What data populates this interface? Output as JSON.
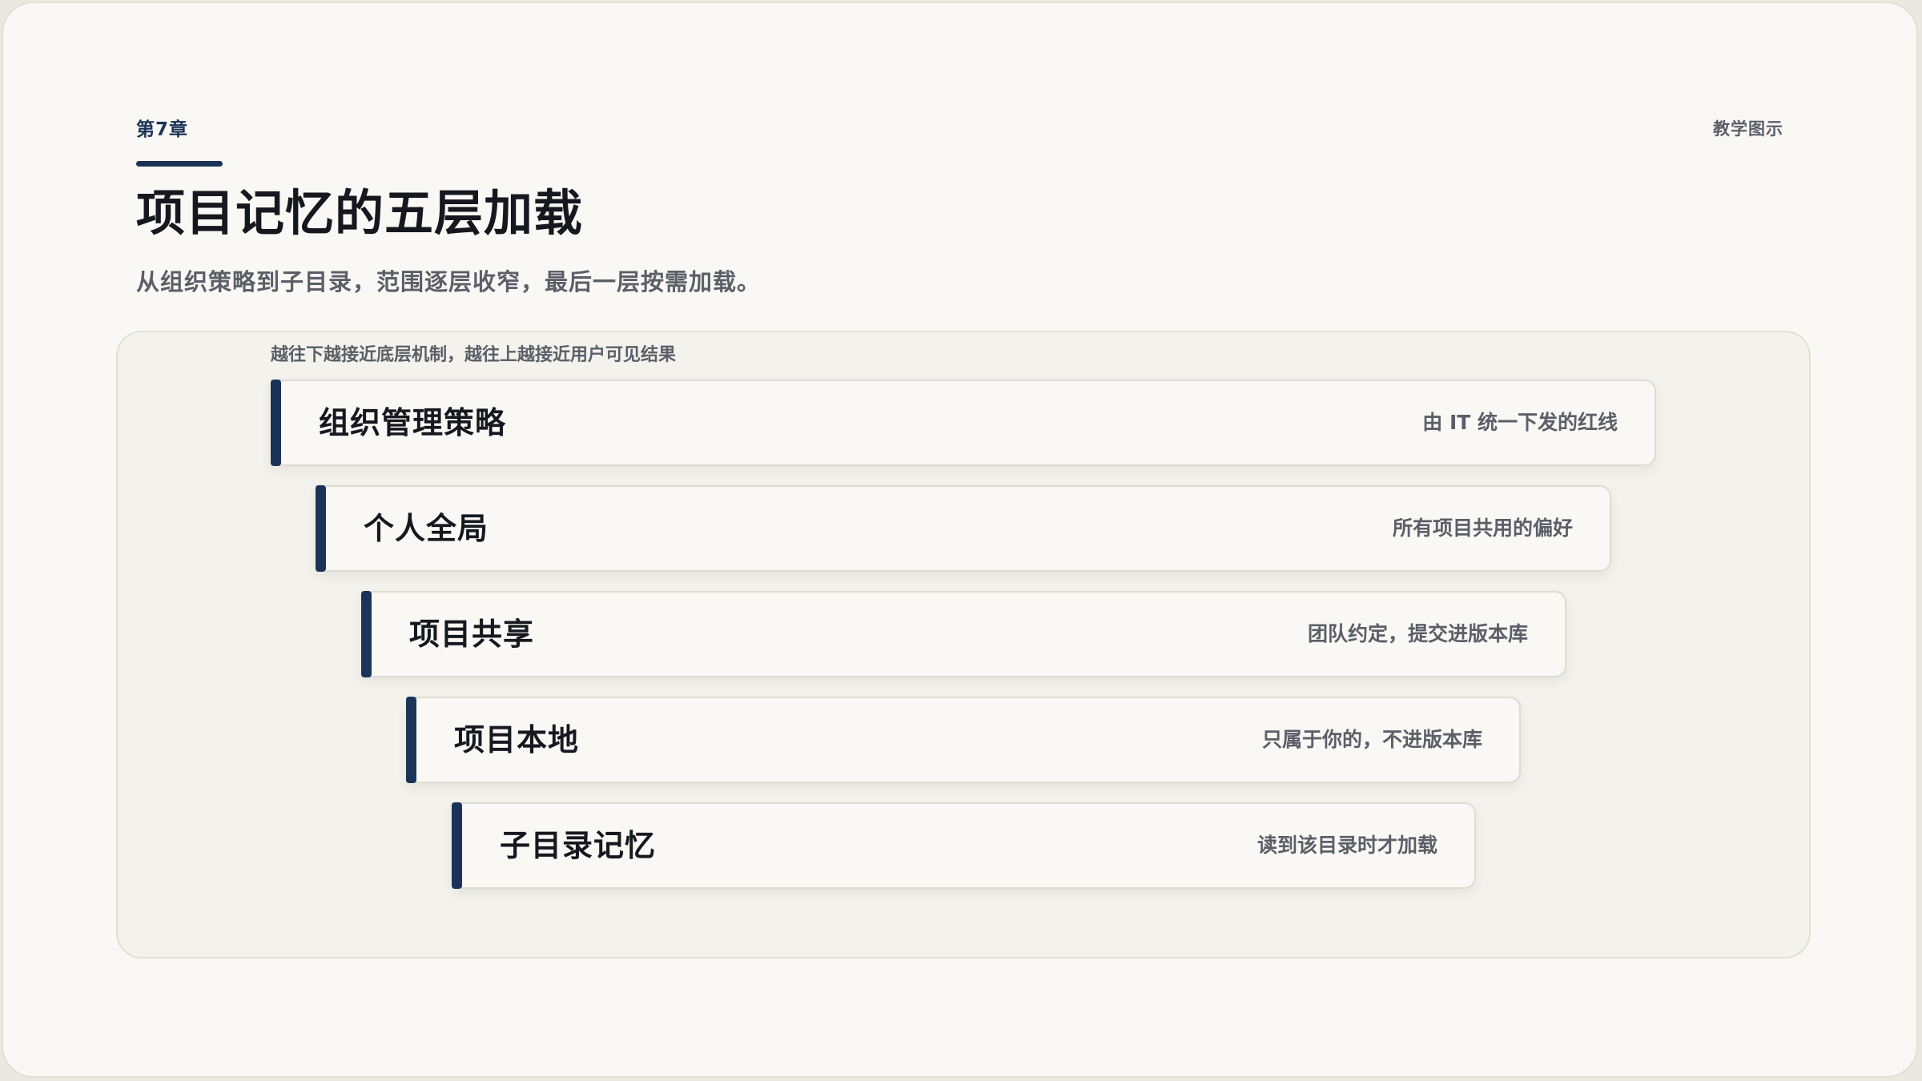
{
  "header": {
    "chapter": "第7章",
    "tag": "教学图示",
    "title": "项目记忆的五层加载",
    "subtitle": "从组织策略到子目录，范围逐层收窄，最后一层按需加载。"
  },
  "diagram": {
    "caption": "越往下越接近底层机制，越往上越接近用户可见结果",
    "layers": [
      {
        "name": "组织管理策略",
        "description": "由 IT 统一下发的红线"
      },
      {
        "name": "个人全局",
        "description": "所有项目共用的偏好"
      },
      {
        "name": "项目共享",
        "description": "团队约定，提交进版本库"
      },
      {
        "name": "项目本地",
        "description": "只属于你的，不进版本库"
      },
      {
        "name": "子目录记忆",
        "description": "读到该目录时才加载"
      }
    ]
  },
  "colors": {
    "accent": "#1b3358",
    "background": "#f9f8f4",
    "panel": "#f3f2ec",
    "text_primary": "#15181f",
    "text_secondary": "#5b5f68"
  }
}
